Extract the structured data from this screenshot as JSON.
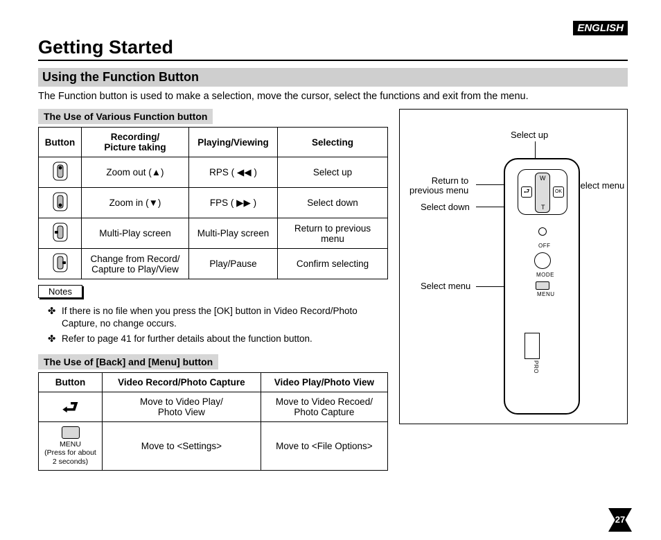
{
  "language_badge": "ENGLISH",
  "title": "Getting Started",
  "subtitle": "Using the Function Button",
  "intro": "The Function button is used to make a selection, move the cursor, select the functions and exit from the menu.",
  "section1_label": "The Use of Various Function button",
  "table1": {
    "headers": [
      "Button",
      "Recording/\nPicture taking",
      "Playing/Viewing",
      "Selecting"
    ],
    "rows": [
      {
        "recording": "Zoom out (▲)",
        "playing": "RPS ( ◀◀ )",
        "selecting": "Select up"
      },
      {
        "recording": "Zoom in (▼)",
        "playing": "FPS ( ▶▶ )",
        "selecting": "Select down"
      },
      {
        "recording": "Multi-Play screen",
        "playing": "Multi-Play screen",
        "selecting": "Return to previous menu"
      },
      {
        "recording": "Change from Record/\nCapture to Play/View",
        "playing": "Play/Pause",
        "selecting": "Confirm selecting"
      }
    ]
  },
  "notes_label": "Notes",
  "notes": [
    "If there is no file when you press the [OK] button in Video Record/Photo Capture, no change occurs.",
    "Refer to page 41 for further details about the function button."
  ],
  "section2_label": "The Use of [Back] and [Menu] button",
  "table2": {
    "headers": [
      "Button",
      "Video Record/Photo Capture",
      "Video Play/Photo View"
    ],
    "rows": [
      {
        "button_kind": "back",
        "col1": "Move to Video Play/\nPhoto View",
        "col2": "Move to Video Recoed/\nPhoto Capture"
      },
      {
        "button_kind": "menu",
        "menu_label": "MENU",
        "menu_sub": "(Press for about\n2 seconds)",
        "col1": "Move to <Settings>",
        "col2": "Move to <File Options>"
      }
    ]
  },
  "diagram": {
    "select_up": "Select up",
    "return_prev": "Return to\nprevious menu",
    "select_down": "Select down",
    "select_menu_right": "Select menu",
    "select_menu_left": "Select menu",
    "w": "W",
    "t": "T",
    "ok": "OK",
    "back": "⤶",
    "off": "OFF",
    "mode": "MODE",
    "menu": "MENU",
    "pro": "PRO"
  },
  "page_number": "27"
}
